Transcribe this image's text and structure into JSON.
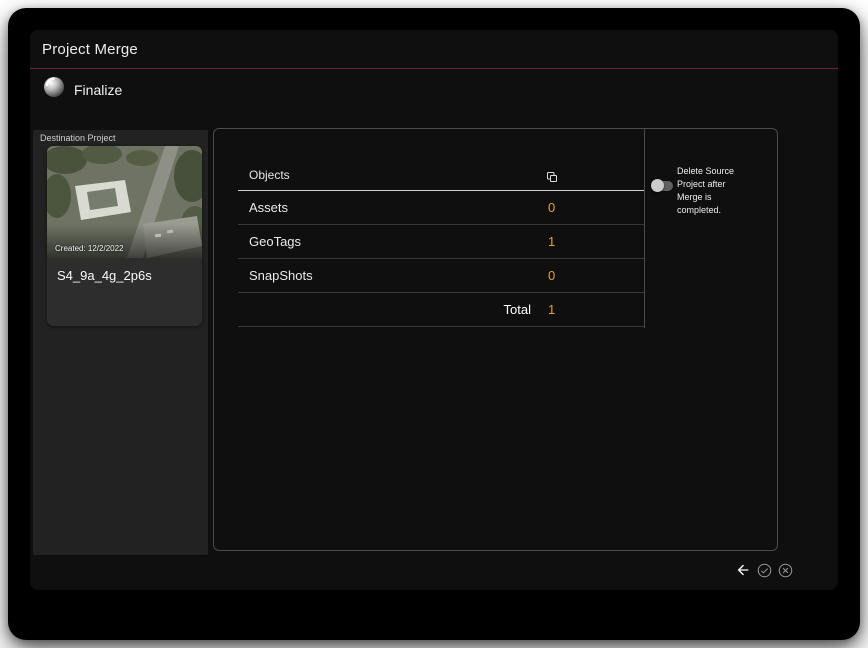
{
  "window": {
    "title": "Project Merge"
  },
  "wizard": {
    "step_label": "Finalize"
  },
  "destination": {
    "section_label": "Destination Project",
    "created_label": "Created: 12/2/2022",
    "project_name": "S4_9a_4g_2p6s"
  },
  "table": {
    "header_label": "Objects",
    "rows": [
      {
        "label": "Assets",
        "value": "0"
      },
      {
        "label": "GeoTags",
        "value": "1"
      },
      {
        "label": "SnapShots",
        "value": "0"
      }
    ],
    "total_label": "Total",
    "total_value": "1"
  },
  "options": {
    "delete_source_label": "Delete Source Project after Merge is completed.",
    "toggle_state": "off"
  },
  "icons": {
    "finalize": "orb-icon",
    "objects_header": "count-icon",
    "back": "back-arrow-icon",
    "confirm": "check-circle-icon",
    "cancel": "close-circle-icon"
  },
  "colors": {
    "value_accent": "#E2A13C",
    "header_divider": "#6B2228",
    "panel_border": "#4B4B4B"
  }
}
